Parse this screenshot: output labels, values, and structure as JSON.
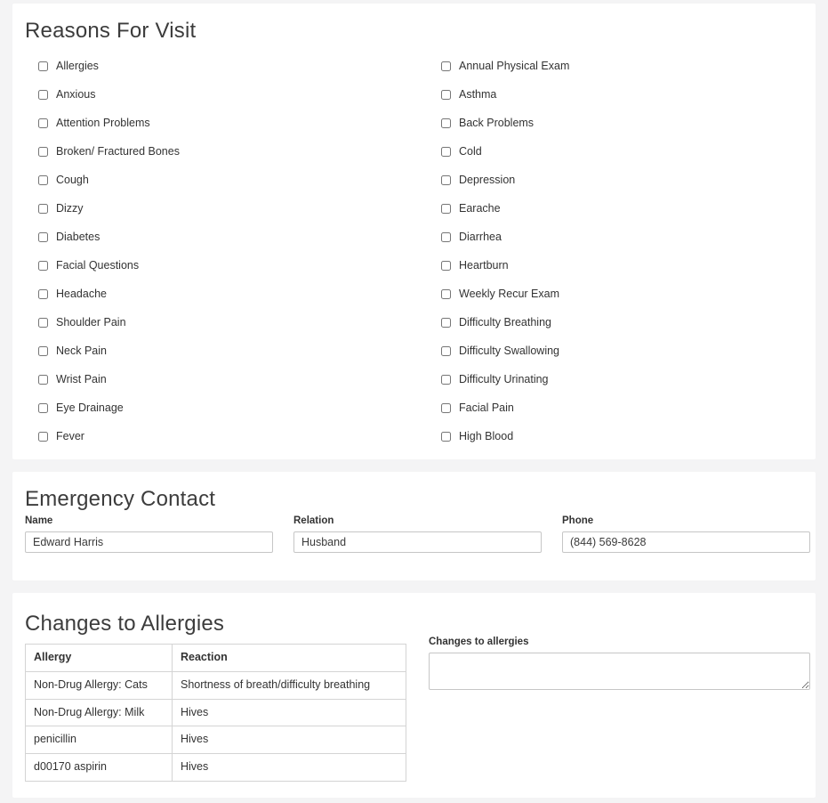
{
  "sections": {
    "reasons": {
      "title": "Reasons For Visit",
      "left_column": [
        "Allergies",
        "Anxious",
        "Attention Problems",
        "Broken/ Fractured Bones",
        "Cough",
        "Dizzy",
        "Diabetes",
        "Facial Questions",
        "Headache",
        "Shoulder Pain",
        "Neck Pain",
        "Wrist Pain",
        "Eye Drainage",
        "Fever"
      ],
      "right_column": [
        "Annual Physical Exam",
        "Asthma",
        "Back Problems",
        "Cold",
        "Depression",
        "Earache",
        "Diarrhea",
        "Heartburn",
        "Weekly Recur Exam",
        "Difficulty Breathing",
        "Difficulty Swallowing",
        "Difficulty Urinating",
        "Facial Pain",
        "High Blood"
      ]
    },
    "emergency": {
      "title": "Emergency Contact",
      "fields": [
        {
          "label": "Name",
          "value": "Edward Harris"
        },
        {
          "label": "Relation",
          "value": "Husband"
        },
        {
          "label": "Phone",
          "value": "(844) 569-8628"
        }
      ]
    },
    "allergies": {
      "title": "Changes to Allergies",
      "table": {
        "headers": [
          "Allergy",
          "Reaction"
        ],
        "rows": [
          [
            "Non-Drug Allergy: Cats",
            "Shortness of breath/difficulty breathing"
          ],
          [
            "Non-Drug Allergy: Milk",
            "Hives"
          ],
          [
            "penicillin",
            "Hives"
          ],
          [
            "d00170 aspirin",
            "Hives"
          ]
        ]
      },
      "changes_label": "Changes to allergies",
      "changes_value": ""
    }
  },
  "colors": {
    "page_background": "#f4f4f5",
    "card_background": "#ffffff",
    "text": "#333333",
    "heading": "#3c3c3c",
    "border": "#c6c6c6",
    "table_border": "#d4d4d4"
  }
}
